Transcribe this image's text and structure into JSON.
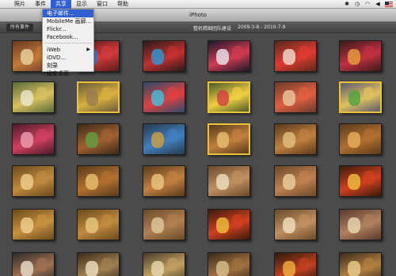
{
  "menubar": {
    "items": [
      "照片",
      "事件",
      "共享",
      "显示",
      "窗口",
      "帮助"
    ],
    "active_index": 2
  },
  "window": {
    "title": "iPhoto"
  },
  "events_bar": {
    "all_events_label": "所有事件",
    "event_title": "整机精细团队建设",
    "event_date": "2009-3-8 - 2010-7-9"
  },
  "share_menu": {
    "items": [
      {
        "label": "电子邮件...",
        "highlighted": true
      },
      {
        "label": "MobileMe 画廊..."
      },
      {
        "label": "Flickr..."
      },
      {
        "label": "Facebook..."
      },
      {
        "separator": true
      },
      {
        "label": "iWeb",
        "submenu": true
      },
      {
        "label": "iDVD..."
      },
      {
        "label": "刻录"
      },
      {
        "label": "设定桌面"
      }
    ]
  },
  "photos": [
    {
      "selected": false,
      "c1": "#6b3a22",
      "c2": "#c47a3a",
      "c3": "#e8d5a0"
    },
    {
      "selected": false,
      "c1": "#5a1a1a",
      "c2": "#d23a3a",
      "c3": "#3a7ad2"
    },
    {
      "selected": false,
      "c1": "#2a1a1a",
      "c2": "#c23030",
      "c3": "#2a9ad8"
    },
    {
      "selected": false,
      "c1": "#1a1a2a",
      "c2": "#d23a50",
      "c3": "#e8e8f0"
    },
    {
      "selected": false,
      "c1": "#5a2a1a",
      "c2": "#e03a30",
      "c3": "#f0e0d0"
    },
    {
      "selected": false,
      "c1": "#3a1a1a",
      "c2": "#c03040",
      "c3": "#e8a040"
    },
    {
      "selected": false,
      "c1": "#5a6a3a",
      "c2": "#d8c060",
      "c3": "#e8e8d0"
    },
    {
      "selected": true,
      "c1": "#6a5a3a",
      "c2": "#d8b040",
      "c3": "#9a7a50"
    },
    {
      "selected": false,
      "c1": "#2a4a6a",
      "c2": "#e04040",
      "c3": "#40c0e0"
    },
    {
      "selected": true,
      "c1": "#4a5a2a",
      "c2": "#f0d040",
      "c3": "#d04040"
    },
    {
      "selected": false,
      "c1": "#6a3a2a",
      "c2": "#e06040",
      "c3": "#e8c8a0"
    },
    {
      "selected": true,
      "c1": "#5a5a6a",
      "c2": "#e0c060",
      "c3": "#50a040"
    },
    {
      "selected": false,
      "c1": "#4a1a2a",
      "c2": "#d04060",
      "c3": "#e8a0b0"
    },
    {
      "selected": false,
      "c1": "#3a2a1a",
      "c2": "#a06030",
      "c3": "#60a040"
    },
    {
      "selected": false,
      "c1": "#2a3a4a",
      "c2": "#4080c0",
      "c3": "#d0a040"
    },
    {
      "selected": true,
      "c1": "#5a3a1a",
      "c2": "#c08040",
      "c3": "#e8c070"
    },
    {
      "selected": false,
      "c1": "#5a3a1a",
      "c2": "#c08040",
      "c3": "#e0c080"
    },
    {
      "selected": false,
      "c1": "#5a3a1a",
      "c2": "#b07030",
      "c3": "#e8b060"
    },
    {
      "selected": false,
      "c1": "#6a4a1a",
      "c2": "#c08a40",
      "c3": "#f0d090"
    },
    {
      "selected": false,
      "c1": "#5a3a1a",
      "c2": "#b07030",
      "c3": "#e8c070"
    },
    {
      "selected": false,
      "c1": "#5a3a1a",
      "c2": "#c08040",
      "c3": "#e8c880"
    },
    {
      "selected": false,
      "c1": "#6a4a2a",
      "c2": "#c09060",
      "c3": "#f0e0c0"
    },
    {
      "selected": false,
      "c1": "#6a4a2a",
      "c2": "#c08050",
      "c3": "#e8d0a0"
    },
    {
      "selected": false,
      "c1": "#3a1a0a",
      "c2": "#d04020",
      "c3": "#f0c040"
    },
    {
      "selected": false,
      "c1": "#6a4a1a",
      "c2": "#c89040",
      "c3": "#f0d090"
    },
    {
      "selected": false,
      "c1": "#6a4a1a",
      "c2": "#c08a40",
      "c3": "#e8c880"
    },
    {
      "selected": false,
      "c1": "#6a4a2a",
      "c2": "#b08050",
      "c3": "#e0c8a0"
    },
    {
      "selected": false,
      "c1": "#3a1a0a",
      "c2": "#d04020",
      "c3": "#f0c040"
    },
    {
      "selected": false,
      "c1": "#6a4a2a",
      "c2": "#c09060",
      "c3": "#f0e0c0"
    },
    {
      "selected": false,
      "c1": "#5a3a2a",
      "c2": "#b08060",
      "c3": "#e8d8b0"
    },
    {
      "selected": false,
      "c1": "#2a2a2a",
      "c2": "#a07050",
      "c3": "#e8e0d0"
    },
    {
      "selected": false,
      "c1": "#3a2a1a",
      "c2": "#a08050",
      "c3": "#f0e0c0"
    },
    {
      "selected": false,
      "c1": "#4a3a2a",
      "c2": "#c0a060",
      "c3": "#e8d8b0"
    },
    {
      "selected": false,
      "c1": "#3a2a1a",
      "c2": "#a07040",
      "c3": "#d8c090"
    },
    {
      "selected": false,
      "c1": "#2a1a0a",
      "c2": "#c04020",
      "c3": "#f0b040"
    },
    {
      "selected": false,
      "c1": "#3a2a1a",
      "c2": "#b08040",
      "c3": "#e8d090"
    }
  ]
}
